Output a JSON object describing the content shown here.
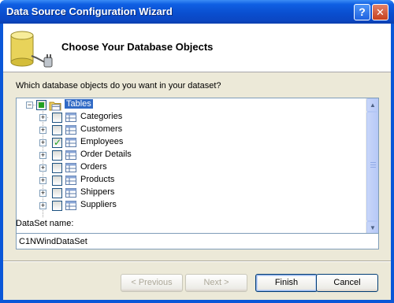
{
  "window": {
    "title": "Data Source Configuration Wizard"
  },
  "titlebar_buttons": {
    "help": "?",
    "close": "✕"
  },
  "header": {
    "title": "Choose Your Database Objects"
  },
  "question": "Which database objects do you want in your dataset?",
  "tree": {
    "root": {
      "label": "Tables",
      "expander": "−",
      "state": "partial"
    },
    "items": [
      {
        "label": "Categories",
        "checked": false
      },
      {
        "label": "Customers",
        "checked": false
      },
      {
        "label": "Employees",
        "checked": true
      },
      {
        "label": "Order Details",
        "checked": false
      },
      {
        "label": "Orders",
        "checked": false
      },
      {
        "label": "Products",
        "checked": false
      },
      {
        "label": "Shippers",
        "checked": false
      },
      {
        "label": "Suppliers",
        "checked": false
      }
    ]
  },
  "dataset": {
    "label": "DataSet name:",
    "value": "C1NWindDataSet"
  },
  "buttons": {
    "previous": "< Previous",
    "next": "Next >",
    "finish": "Finish",
    "cancel": "Cancel"
  },
  "colors": {
    "titlebar": "#0a4fd0",
    "selection": "#316ac5",
    "check": "#21a121"
  }
}
